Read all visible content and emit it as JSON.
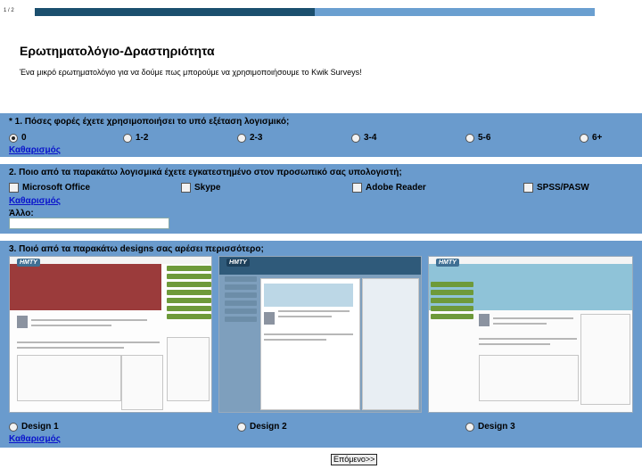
{
  "progress": {
    "page_text": "1 / 2",
    "fraction": 0.5
  },
  "header": {
    "title": "Ερωτηματολόγιο-Δραστηριότητα",
    "subtitle": "Ένα μικρό ερωτηματολόγιο για να δούμε πως μπορούμε να χρησιμοποιήσουμε το Kwik Surveys!"
  },
  "q1": {
    "title": "* 1. Πόσες φορές έχετε χρησιμοποιήσει το υπό εξέταση λογισμικό;",
    "options": [
      "0",
      "1-2",
      "2-3",
      "3-4",
      "5-6",
      "6+"
    ],
    "selected": "0",
    "clear": "Καθαρισμός"
  },
  "q2": {
    "title": "2. Ποιο από τα παρακάτω λογισμικά έχετε εγκατεστημένο στον προσωπικό σας υπολογιστή;",
    "options": [
      "Microsoft Office",
      "Skype",
      "Adobe Reader",
      "SPSS/PASW"
    ],
    "clear": "Καθαρισμός",
    "other_label": "Άλλο:",
    "other_value": ""
  },
  "q3": {
    "title": "3. Ποιό από τα παρακάτω designs σας αρέσει περισσότερο;",
    "options": [
      "Design 1",
      "Design 2",
      "Design 3"
    ],
    "clear": "Καθαρισμός",
    "thumbs": [
      {
        "logo": "HMTY",
        "banner": "#9b3b3b",
        "nav": "#6e9a3a"
      },
      {
        "logo": "HMTY",
        "banner": "#2f5a7a",
        "nav": "#6c8da8"
      },
      {
        "logo": "HMTY",
        "banner": "#8fc3d8",
        "nav": "#6e9a3a"
      }
    ]
  },
  "next_label": "Επόμενο>>",
  "colors": {
    "panel": "#6a9bcd",
    "progress_fill": "#1b4f6e",
    "progress_track": "#6a9fd0",
    "link": "#0a14cc"
  }
}
